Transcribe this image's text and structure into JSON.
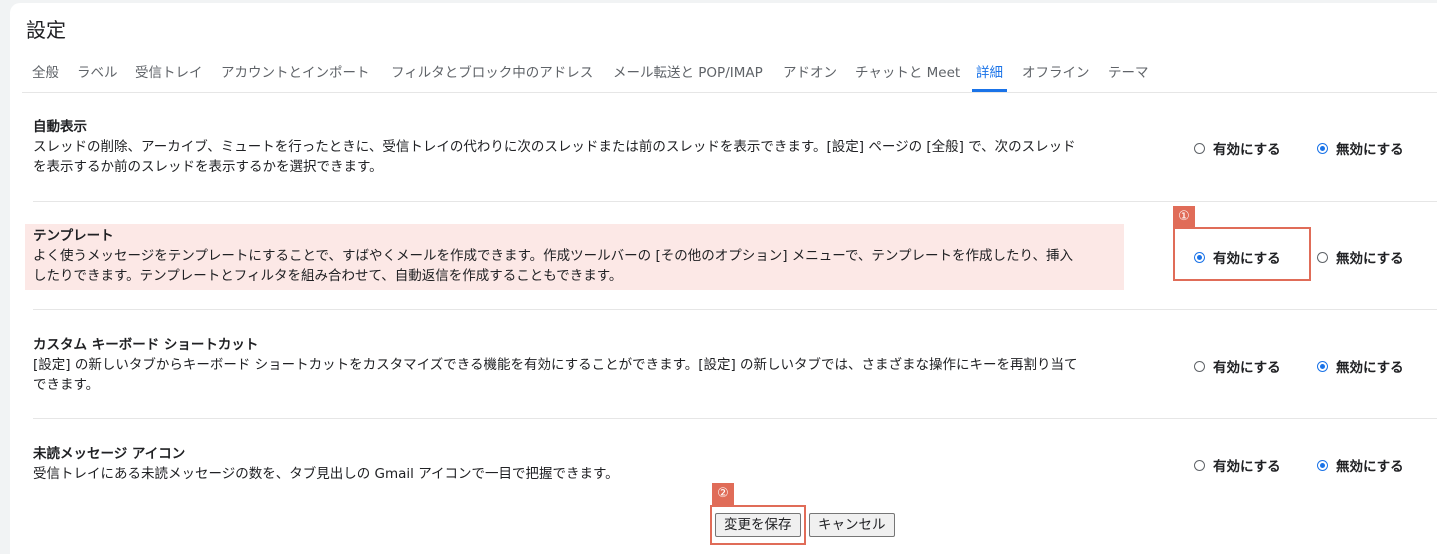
{
  "page": {
    "title": "設定"
  },
  "tabs": [
    {
      "label": "全般"
    },
    {
      "label": "ラベル"
    },
    {
      "label": "受信トレイ"
    },
    {
      "label": "アカウントとインポート"
    },
    {
      "label": "フィルタとブロック中のアドレス"
    },
    {
      "label": "メール転送と POP/IMAP"
    },
    {
      "label": "アドオン"
    },
    {
      "label": "チャットと Meet"
    },
    {
      "label": "詳細",
      "active": true
    },
    {
      "label": "オフライン"
    },
    {
      "label": "テーマ"
    }
  ],
  "settings": [
    {
      "name": "自動表示",
      "desc_line1": "スレッドの削除、アーカイブ、ミュートを行ったときに、受信トレイの代わりに次のスレッドまたは前のスレッドを表示できます。[設定] ページの [全般] で、次のスレッド",
      "desc_line2": "を表示するか前のスレッドを表示するかを選択できます。",
      "enable_label": "有効にする",
      "disable_label": "無効にする",
      "selected": "disable"
    },
    {
      "name": "テンプレート",
      "desc_line1": "よく使うメッセージをテンプレートにすることで、すばやくメールを作成できます。作成ツールバーの [その他のオプション] メニューで、テンプレートを作成したり、挿入",
      "desc_line2": "したりできます。テンプレートとフィルタを組み合わせて、自動返信を作成することもできます。",
      "enable_label": "有効にする",
      "disable_label": "無効にする",
      "selected": "enable"
    },
    {
      "name": "カスタム キーボード ショートカット",
      "desc_line1": "[設定] の新しいタブからキーボード ショートカットをカスタマイズできる機能を有効にすることができます。[設定] の新しいタブでは、さまざまな操作にキーを再割り当て",
      "desc_line2": "できます。",
      "enable_label": "有効にする",
      "disable_label": "無効にする",
      "selected": "disable"
    },
    {
      "name": "未読メッセージ アイコン",
      "desc_line1": "受信トレイにある未読メッセージの数を、タブ見出しの Gmail アイコンで一目で把握できます。",
      "desc_line2": "",
      "enable_label": "有効にする",
      "disable_label": "無効にする",
      "selected": "disable"
    }
  ],
  "callouts": {
    "one": "①",
    "two": "②"
  },
  "buttons": {
    "save": "変更を保存",
    "cancel": "キャンセル"
  },
  "colors": {
    "accent": "#1a73e8",
    "callout": "#e06c58",
    "highlight": "#fce8e6"
  }
}
